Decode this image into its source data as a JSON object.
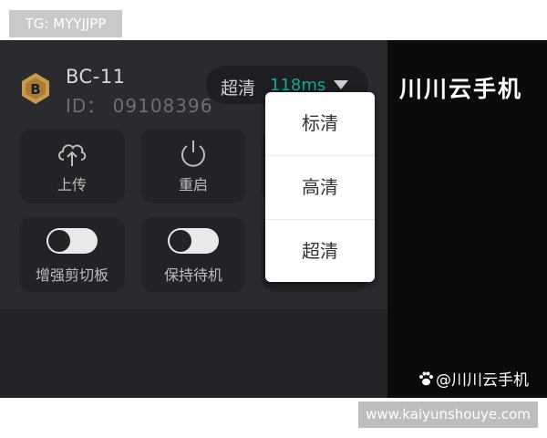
{
  "overlay": {
    "tag_top": "TG: MYYJJPP",
    "tag_bottom": "www.kaiyunshouye.com"
  },
  "device": {
    "name": "BC-11",
    "id": "ID： 09108396"
  },
  "quality": {
    "current": "超清",
    "latency": "118ms"
  },
  "quality_menu": {
    "options": [
      "标清",
      "高清",
      "超清"
    ]
  },
  "tiles": {
    "upload": "上传",
    "restart": "重启",
    "clipboard": "增强剪切板",
    "standby": "保持待机"
  },
  "brand": {
    "title": "川川云手机",
    "watermark": "@川川云手机"
  },
  "colors": {
    "panel": "#2a2b2f",
    "tile": "#222326",
    "latency": "#1aa89a",
    "logo": "#c99a4e"
  }
}
